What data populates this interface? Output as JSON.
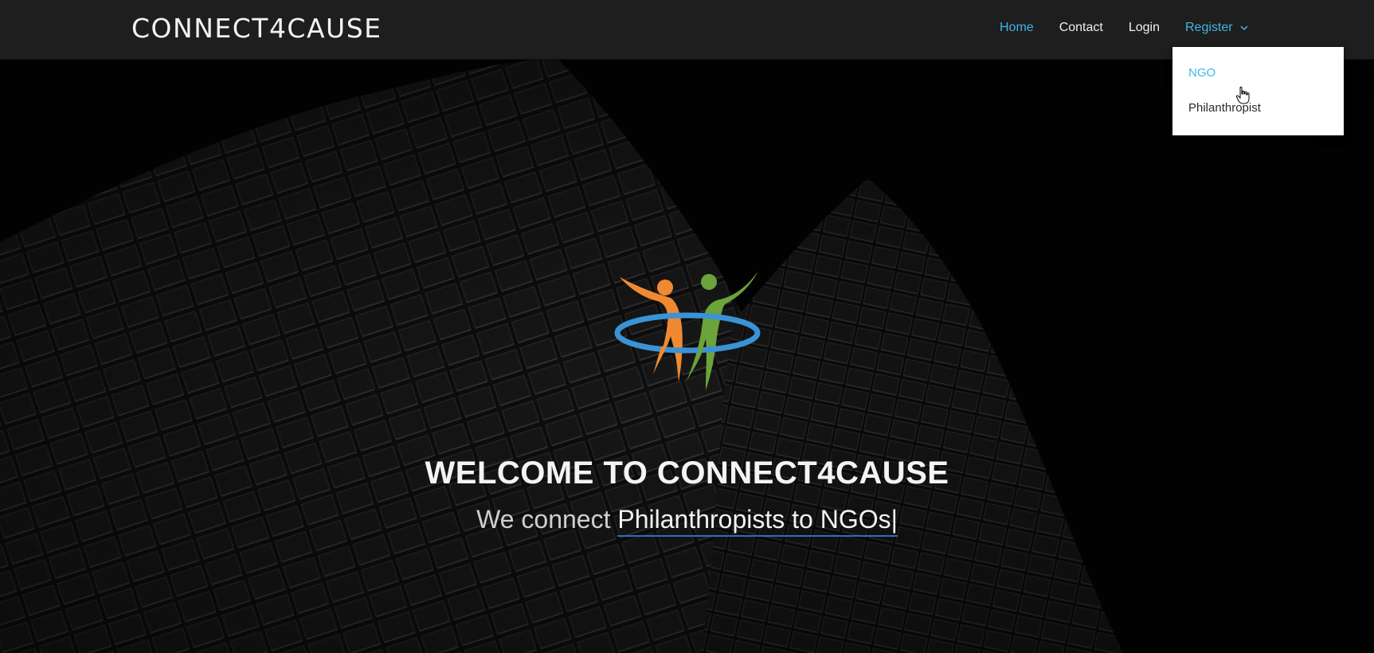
{
  "header": {
    "brand": "CONNECT4CAUSE",
    "nav": {
      "home": "Home",
      "contact": "Contact",
      "login": "Login",
      "register": "Register"
    }
  },
  "register_dropdown": {
    "items": [
      "NGO",
      "Philanthropist"
    ]
  },
  "hero": {
    "title": "WELCOME TO CONNECT4CAUSE",
    "tagline_prefix": "We connect ",
    "tagline_typed": "Philanthropists to NGOs|"
  },
  "colors": {
    "accent": "#3fb6e6",
    "header_bg": "#1e1e1e",
    "logo_orange": "#f08a32",
    "logo_green": "#6aa43a",
    "logo_blue": "#3a93d6"
  },
  "icons": {
    "register_chevron": "chevron-down-icon",
    "pointer": "hand-pointer-icon"
  }
}
